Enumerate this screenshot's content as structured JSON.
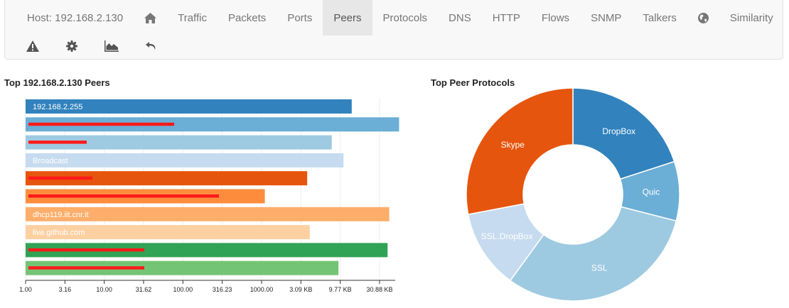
{
  "nav": {
    "host_label": "Host: 192.168.2.130",
    "tabs": [
      {
        "label": "Traffic"
      },
      {
        "label": "Packets"
      },
      {
        "label": "Ports"
      },
      {
        "label": "Peers",
        "active": true
      },
      {
        "label": "Protocols"
      },
      {
        "label": "DNS"
      },
      {
        "label": "HTTP"
      },
      {
        "label": "Flows"
      },
      {
        "label": "SNMP"
      },
      {
        "label": "Talkers"
      },
      {
        "label": "Similarity"
      }
    ],
    "icons": [
      "home-icon",
      "globe-icon",
      "warning-icon",
      "gear-icon",
      "area-chart-icon",
      "undo-icon"
    ]
  },
  "peers_section": {
    "title": "Top 192.168.2.130 Peers"
  },
  "protocols_section": {
    "title": "Top Peer Protocols"
  },
  "chart_data": [
    {
      "type": "bar",
      "orientation": "horizontal",
      "x_scale": "log",
      "categories": [
        "192.168.2.255",
        "",
        "",
        "Broadcast",
        "",
        "",
        "dhcp119.iit.cnr.it",
        "live.github.com",
        "",
        ""
      ],
      "redacted": [
        false,
        true,
        true,
        false,
        true,
        true,
        false,
        false,
        true,
        true
      ],
      "values": [
        14000,
        56000,
        7800,
        11000,
        3800,
        1100,
        42000,
        4100,
        40000,
        9500
      ],
      "colors": [
        "#3182bd",
        "#6baed6",
        "#9ecae1",
        "#c6dbef",
        "#e6550d",
        "#fd8d3c",
        "#fdae6b",
        "#fdd0a2",
        "#31a354",
        "#74c476"
      ],
      "xlim": [
        1,
        50000
      ],
      "tick_labels": [
        "1.00",
        "3.16",
        "10.00",
        "31.62",
        "100.00",
        "316.23",
        "1000.00",
        "3.09 KB",
        "9.77 KB",
        "30.88 KB"
      ]
    },
    {
      "type": "pie",
      "donut": true,
      "labels": [
        "DropBox",
        "Quic",
        "SSL",
        "SSL.DropBox",
        "Skype"
      ],
      "values": [
        20,
        9,
        31,
        12,
        28
      ],
      "colors": [
        "#3182bd",
        "#6baed6",
        "#9ecae1",
        "#c6dbef",
        "#e6550d"
      ]
    }
  ]
}
